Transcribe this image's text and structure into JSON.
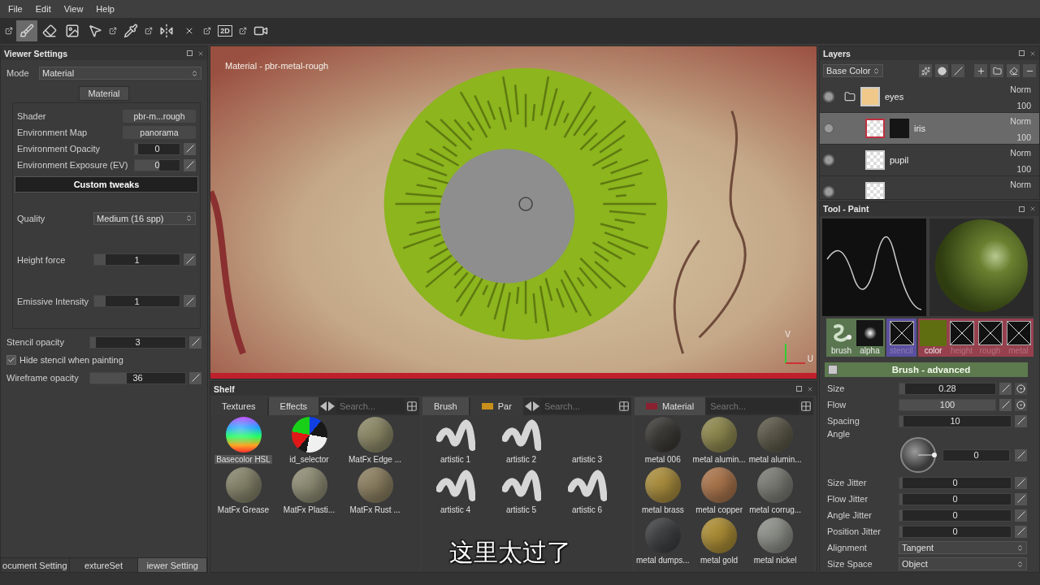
{
  "menu": [
    "File",
    "Edit",
    "View",
    "Help"
  ],
  "toolbar": [
    {
      "kind": "popout",
      "selected": false
    },
    {
      "kind": "brush",
      "selected": true
    },
    {
      "kind": "eraser",
      "selected": false
    },
    {
      "kind": "projection",
      "selected": false
    },
    {
      "kind": "polyfill",
      "selected": false
    },
    {
      "kind": "popout",
      "selected": false
    },
    {
      "kind": "picker",
      "selected": false
    },
    {
      "kind": "popout",
      "selected": false
    },
    {
      "kind": "symmetry",
      "selected": false
    },
    {
      "kind": "particles",
      "selected": false
    },
    {
      "kind": "popout",
      "selected": false
    },
    {
      "kind": "view2d",
      "label": "2D",
      "selected": false
    },
    {
      "kind": "popout",
      "selected": false
    },
    {
      "kind": "camera",
      "selected": false
    }
  ],
  "viewer_settings": {
    "title": "Viewer Settings",
    "mode": {
      "label": "Mode",
      "value": "Material"
    },
    "section_tab": "Material",
    "rows": [
      {
        "kind": "button",
        "label": "Shader",
        "value": "pbr-m...rough"
      },
      {
        "kind": "button",
        "label": "Environment Map",
        "value": "panorama"
      },
      {
        "kind": "slider",
        "label": "Environment Opacity",
        "value": "0",
        "level": 0
      },
      {
        "kind": "slider",
        "label": "Environment Exposure (EV)",
        "value": "0",
        "level": 0.5
      }
    ],
    "custom_tweaks": "Custom tweaks",
    "tweaks": [
      {
        "kind": "select",
        "label": "Quality",
        "value": "Medium (16 spp)"
      },
      {
        "kind": "slider",
        "label": "Height force",
        "value": "1",
        "level": 0.1
      },
      {
        "kind": "slider",
        "label": "Emissive Intensity",
        "value": "1",
        "level": 0.1
      }
    ],
    "extra": [
      {
        "kind": "slider",
        "label": "Stencil opacity",
        "value": "3",
        "level": 0.03
      },
      {
        "kind": "checkbox",
        "label": "Hide stencil when painting",
        "checked": true
      },
      {
        "kind": "slider",
        "label": "Wireframe opacity",
        "value": "36",
        "level": 0.36
      }
    ],
    "bottom_tabs": [
      {
        "label": "ocument Setting",
        "selected": false
      },
      {
        "label": "extureSet",
        "selected": false
      },
      {
        "label": "iewer Setting",
        "selected": true
      }
    ]
  },
  "viewport": {
    "label": "Material - pbr-metal-rough",
    "axis_labels": [
      "V",
      "U"
    ]
  },
  "shelf": {
    "title": "Shelf",
    "panes": [
      {
        "tabs": [
          {
            "label": "Textures",
            "selected": false
          },
          {
            "label": "Effects",
            "selected": true
          }
        ],
        "arrows": true,
        "search_placeholder": "Search...",
        "items": [
          {
            "label": "Basecolor HSL",
            "kind": "hsl",
            "selected": true
          },
          {
            "label": "id_selector",
            "kind": "id",
            "selected": false
          },
          {
            "label": "MatFx Edge ...",
            "kind": "sphere",
            "color": "#8a8766",
            "selected": false
          },
          {
            "label": "MatFx Grease",
            "kind": "sphere",
            "color": "#85836a",
            "selected": false
          },
          {
            "label": "MatFx Plasti...",
            "kind": "sphere",
            "color": "#8e8c74",
            "selected": false
          },
          {
            "label": "MatFx Rust ...",
            "kind": "sphere",
            "color": "#8a7e60",
            "selected": false
          }
        ]
      },
      {
        "tabs": [
          {
            "label": "Brush",
            "selected": true
          },
          {
            "label": "Par",
            "selected": false,
            "color": "#c8901a"
          }
        ],
        "arrows": true,
        "search_placeholder": "Search...",
        "items": [
          {
            "label": "artistic 1",
            "kind": "stroke",
            "selected": false
          },
          {
            "label": "artistic 2",
            "kind": "stroke",
            "selected": false
          },
          {
            "label": "artistic 3",
            "kind": "blank",
            "selected": false
          },
          {
            "label": "artistic 4",
            "kind": "stroke",
            "selected": false
          },
          {
            "label": "artistic 5",
            "kind": "stroke",
            "selected": false
          },
          {
            "label": "artistic 6",
            "kind": "stroke",
            "selected": false
          }
        ]
      },
      {
        "tabs": [
          {
            "label": "Material",
            "selected": true,
            "color": "#8a2030"
          }
        ],
        "arrows": false,
        "search_placeholder": "Search...",
        "items": [
          {
            "label": "metal 006",
            "kind": "sphere",
            "color": "#3c3a36",
            "selected": false
          },
          {
            "label": "metal alumin...",
            "kind": "sphere",
            "color": "#8c864e",
            "selected": false
          },
          {
            "label": "metal alumin...",
            "kind": "sphere",
            "color": "#5c5849",
            "selected": false
          },
          {
            "label": "metal brass",
            "kind": "sphere",
            "color": "#a88c3e",
            "selected": false
          },
          {
            "label": "metal copper",
            "kind": "sphere",
            "color": "#a8744c",
            "selected": false
          },
          {
            "label": "metal corrug...",
            "kind": "sphere",
            "color": "#7a7a74",
            "selected": false
          },
          {
            "label": "metal dumps...",
            "kind": "sphere",
            "color": "#3e4042",
            "selected": false
          },
          {
            "label": "metal gold",
            "kind": "sphere",
            "color": "#aa8c36",
            "selected": false
          },
          {
            "label": "metal nickel",
            "kind": "sphere",
            "color": "#8c8e88",
            "selected": false
          }
        ]
      }
    ]
  },
  "layers": {
    "title": "Layers",
    "channel": "Base Color",
    "items": [
      {
        "name": "eyes",
        "kind": "folder",
        "color": "#f0c98a",
        "blend": "Norm",
        "opacity": "100",
        "visible": true,
        "selected": false,
        "children": [
          {
            "name": "iris",
            "kind": "fill",
            "mask": true,
            "blend": "Norm",
            "opacity": "100",
            "visible": true,
            "selected": true
          },
          {
            "name": "pupil",
            "kind": "fill",
            "mask": false,
            "blend": "Norm",
            "opacity": "100",
            "visible": true,
            "selected": false
          },
          {
            "kind": "fill",
            "mask": false,
            "blend": "Norm",
            "visible": true,
            "selected": false
          }
        ]
      }
    ]
  },
  "tool": {
    "title": "Tool - Paint",
    "slot_groups": [
      {
        "color": "#5a7650",
        "slots": [
          {
            "kind": "brush",
            "label": "brush",
            "disabled": false
          },
          {
            "kind": "alpha",
            "label": "alpha",
            "disabled": false
          }
        ]
      },
      {
        "color": "#5a50a0",
        "slots": [
          {
            "kind": "empty",
            "label": "stencil",
            "disabled": true
          }
        ]
      },
      {
        "color": "#96404e",
        "slots": [
          {
            "kind": "color",
            "label": "color",
            "color": "#5f6e10",
            "disabled": false
          },
          {
            "kind": "empty",
            "label": "height",
            "disabled": true
          },
          {
            "kind": "empty",
            "label": "rough",
            "disabled": true
          },
          {
            "kind": "empty",
            "label": "metal",
            "disabled": true
          }
        ]
      }
    ],
    "section": {
      "title": "Brush - advanced",
      "checked": false
    },
    "params": [
      {
        "kind": "slider",
        "label": "Size",
        "value": "0.28",
        "level": 0.03,
        "pressure": true
      },
      {
        "kind": "slider",
        "label": "Flow",
        "value": "100",
        "level": 1,
        "pressure": true
      },
      {
        "kind": "slider",
        "label": "Spacing",
        "value": "10",
        "level": 0.01,
        "pressure": false
      },
      {
        "kind": "dial",
        "label": "Angle",
        "value": "0"
      },
      {
        "kind": "slider",
        "label": "Size Jitter",
        "value": "0",
        "level": 0,
        "pressure": false
      },
      {
        "kind": "slider",
        "label": "Flow Jitter",
        "value": "0",
        "level": 0,
        "pressure": false
      },
      {
        "kind": "slider",
        "label": "Angle Jitter",
        "value": "0",
        "level": 0,
        "pressure": false
      },
      {
        "kind": "slider",
        "label": "Position Jitter",
        "value": "0",
        "level": 0,
        "pressure": false
      },
      {
        "kind": "select",
        "label": "Alignment",
        "value": "Tangent"
      },
      {
        "kind": "select",
        "label": "Size Space",
        "value": "Object"
      }
    ]
  },
  "subtitle": "这里太过了"
}
